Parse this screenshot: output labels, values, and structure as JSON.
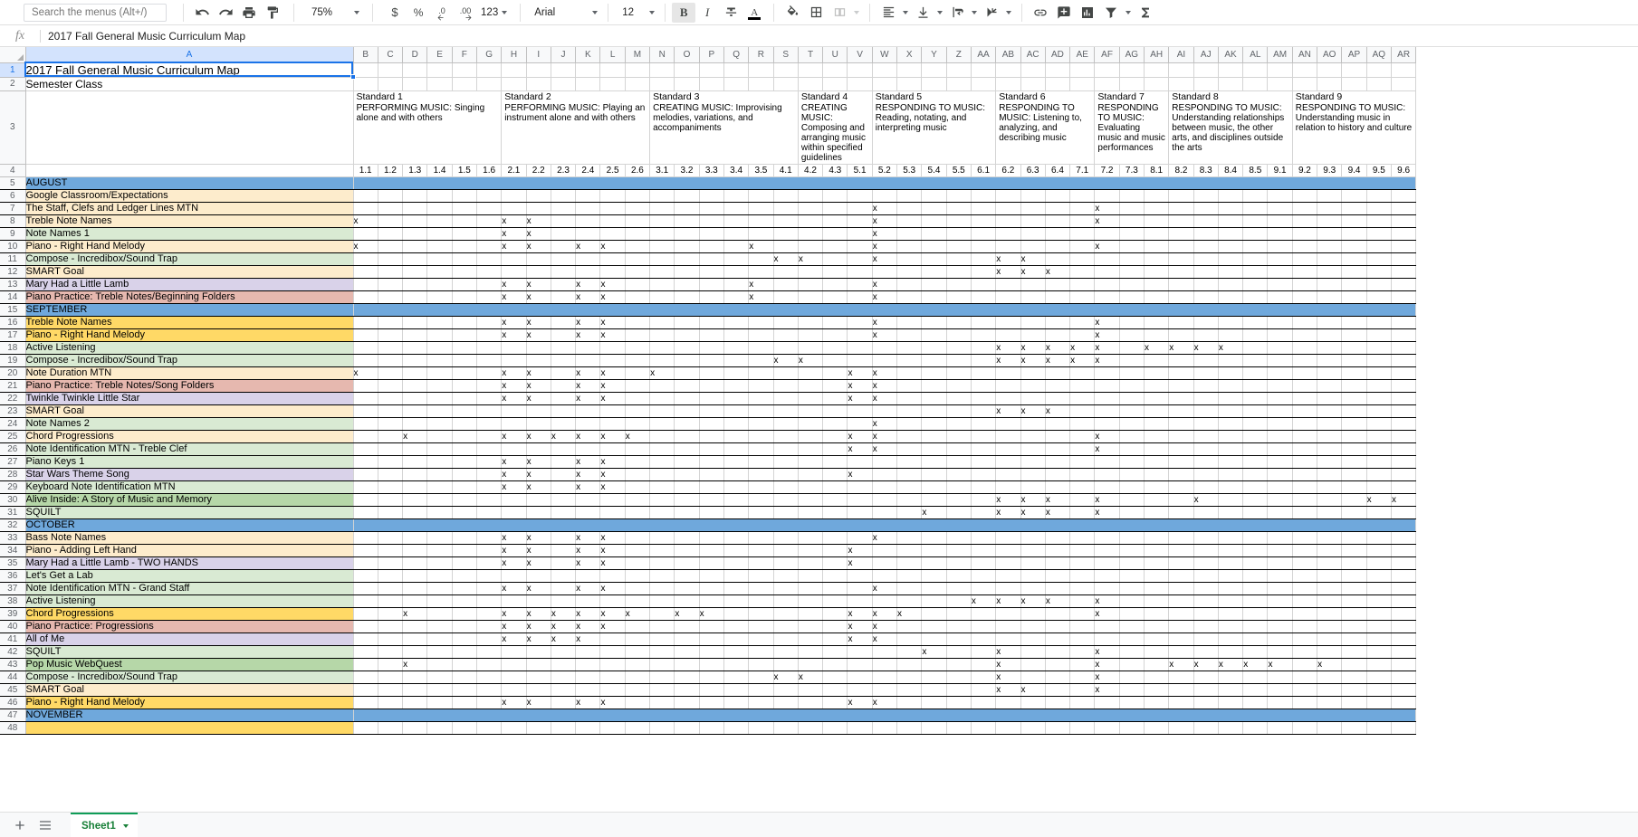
{
  "toolbar": {
    "search_placeholder": "Search the menus (Alt+/)",
    "undo": "undo-icon",
    "redo": "redo-icon",
    "print": "print-icon",
    "paint_format": "paint-format-icon",
    "zoom_value": "75%",
    "currency": "$",
    "percent": "%",
    "decrease_decimal": ".0",
    "increase_decimal": ".00",
    "more_formats": "123",
    "font_family": "Arial",
    "font_size": "12",
    "bold": "B",
    "italic": "I",
    "strikethrough": "S",
    "text_color": "A"
  },
  "formula_bar": {
    "fx_label": "fx",
    "value": "2017 Fall General Music Curriculum Map"
  },
  "columns": [
    "A",
    "B",
    "C",
    "D",
    "E",
    "F",
    "G",
    "H",
    "I",
    "J",
    "K",
    "L",
    "M",
    "N",
    "O",
    "P",
    "Q",
    "R",
    "S",
    "T",
    "U",
    "V",
    "W",
    "X",
    "Y",
    "Z",
    "AA",
    "AB",
    "AC",
    "AD",
    "AE",
    "AF",
    "AG",
    "AH",
    "AI",
    "AJ",
    "AK",
    "AL",
    "AM",
    "AN",
    "AO",
    "AP",
    "AQ",
    "AR"
  ],
  "selected_column": "A",
  "selected_row": 1,
  "header": {
    "title": "2017 Fall General Music Curriculum Map",
    "subtitle": "Semester Class"
  },
  "standards": [
    {
      "col_start": "B",
      "span": 6,
      "name": "Standard 1",
      "description": "PERFORMING MUSIC: Singing alone and with others",
      "subs": [
        "1.1",
        "1.2",
        "1.3",
        "1.4",
        "1.5",
        "1.6"
      ]
    },
    {
      "col_start": "H",
      "span": 6,
      "name": "Standard 2",
      "description": "PERFORMING MUSIC: Playing an instrument alone and with others",
      "subs": [
        "2.1",
        "2.2",
        "2.3",
        "2.4",
        "2.5",
        "2.6"
      ]
    },
    {
      "col_start": "N",
      "span": 6,
      "name": "Standard 3",
      "description": "CREATING MUSIC: Improvising melodies, variations, and accompaniments",
      "subs": [
        "3.1",
        "3.2",
        "3.3",
        "3.4",
        "3.5"
      ]
    },
    {
      "col_start": "T",
      "span": 3,
      "name": "Standard 4",
      "description": "CREATING MUSIC: Composing and arranging music within specified guidelines",
      "subs": [
        "4.1",
        "4.2",
        "4.3"
      ]
    },
    {
      "col_start": "W",
      "span": 5,
      "name": "Standard 5",
      "description": "RESPONDING TO MUSIC: Reading, notating, and interpreting music",
      "subs": [
        "5.1",
        "5.2",
        "5.3",
        "5.4",
        "5.5"
      ]
    },
    {
      "col_start": "AB",
      "span": 4,
      "name": "Standard 6",
      "description": "RESPONDING TO MUSIC: Listening to, analyzing, and describing music",
      "subs": [
        "6.1",
        "6.2",
        "6.3",
        "6.4"
      ]
    },
    {
      "col_start": "AF",
      "span": 3,
      "name": "Standard 7",
      "description": "RESPONDING TO MUSIC: Evaluating music and music performances",
      "subs": [
        "7.1",
        "7.2",
        "7.3"
      ]
    },
    {
      "col_start": "AI",
      "span": 5,
      "name": "Standard 8",
      "description": "RESPONDING TO MUSIC: Understanding relationships between music, the other arts, and disciplines outside the arts",
      "subs": [
        "8.1",
        "8.2",
        "8.3",
        "8.4",
        "8.5"
      ]
    },
    {
      "col_start": "AN",
      "span": 6,
      "name": "Standard 9",
      "description": "RESPONDING TO MUSIC: Understanding music in relation to history and culture",
      "subs": [
        "9.1",
        "9.2",
        "9.3",
        "9.4",
        "9.5",
        "9.6"
      ]
    }
  ],
  "sub_numbers": [
    "1.1",
    "1.2",
    "1.3",
    "1.4",
    "1.5",
    "1.6",
    "2.1",
    "2.2",
    "2.3",
    "2.4",
    "2.5",
    "2.6",
    "3.1",
    "3.2",
    "3.3",
    "3.4",
    "3.5",
    "4.1",
    "4.2",
    "4.3",
    "5.1",
    "5.2",
    "5.3",
    "5.4",
    "5.5",
    "6.1",
    "6.2",
    "6.3",
    "6.4",
    "7.1",
    "7.2",
    "7.3",
    "8.1",
    "8.2",
    "8.3",
    "8.4",
    "8.5",
    "9.1",
    "9.2",
    "9.3",
    "9.4",
    "9.5",
    "9.6"
  ],
  "colors": {
    "month_header": "#6fa8dc",
    "cream": "#fdeccc",
    "green_light": "#d9ead3",
    "green_mid": "#b6d7a8",
    "purple": "#d9d2e9",
    "salmon": "#e6b8af",
    "gold": "#ffd966",
    "white": "#ffffff",
    "accent_blue": "#1a73e8",
    "tab_green": "#0f9d58"
  },
  "rows": [
    {
      "n": 1,
      "label": "2017 Fall General Music Curriculum Map",
      "style": "title",
      "fill": "#ffffff",
      "marks": []
    },
    {
      "n": 2,
      "label": "Semester Class",
      "style": "subtitle",
      "fill": "#ffffff",
      "marks": []
    },
    {
      "n": 3,
      "label": "",
      "style": "std",
      "fill": "#ffffff",
      "marks": []
    },
    {
      "n": 4,
      "label": "",
      "style": "nums",
      "fill": "#ffffff",
      "marks": []
    },
    {
      "n": 5,
      "label": "AUGUST",
      "style": "month",
      "fill": "#6fa8dc",
      "marks": []
    },
    {
      "n": 6,
      "label": "Google Classroom/Expectations",
      "style": "topic",
      "fill": "#fdeccc",
      "marks": []
    },
    {
      "n": 7,
      "label": "The Staff, Clefs and Ledger Lines  MTN",
      "style": "topic",
      "fill": "#fdeccc",
      "marks": [
        "W",
        "AF"
      ]
    },
    {
      "n": 8,
      "label": "Treble Note Names",
      "style": "topic",
      "fill": "#fdeccc",
      "marks": [
        "B",
        "H",
        "I",
        "W",
        "AF"
      ]
    },
    {
      "n": 9,
      "label": "Note Names 1",
      "style": "topic",
      "fill": "#d9ead3",
      "marks": [
        "H",
        "I",
        "W"
      ]
    },
    {
      "n": 10,
      "label": "Piano - Right Hand Melody",
      "style": "topic",
      "fill": "#fdeccc",
      "marks": [
        "B",
        "H",
        "I",
        "K",
        "L",
        "R",
        "W",
        "AF"
      ]
    },
    {
      "n": 11,
      "label": "Compose - Incredibox/Sound Trap",
      "style": "topic",
      "fill": "#d9ead3",
      "marks": [
        "S",
        "T",
        "W",
        "AB",
        "AC"
      ]
    },
    {
      "n": 12,
      "label": "SMART Goal",
      "style": "topic",
      "fill": "#fdeccc",
      "marks": [
        "AB",
        "AC",
        "AD"
      ]
    },
    {
      "n": 13,
      "label": "Mary Had a Little Lamb",
      "style": "topic",
      "fill": "#d9d2e9",
      "marks": [
        "H",
        "I",
        "K",
        "L",
        "R",
        "W"
      ]
    },
    {
      "n": 14,
      "label": "Piano Practice: Treble Notes/Beginning Folders",
      "style": "topic",
      "fill": "#e6b8af",
      "marks": [
        "H",
        "I",
        "K",
        "L",
        "R",
        "W"
      ]
    },
    {
      "n": 15,
      "label": "SEPTEMBER",
      "style": "month",
      "fill": "#6fa8dc",
      "marks": []
    },
    {
      "n": 16,
      "label": "Treble Note Names",
      "style": "topic",
      "fill": "#ffd966",
      "marks": [
        "H",
        "I",
        "K",
        "L",
        "W",
        "AF"
      ]
    },
    {
      "n": 17,
      "label": "Piano - Right Hand Melody",
      "style": "topic",
      "fill": "#ffd966",
      "marks": [
        "H",
        "I",
        "K",
        "L",
        "W",
        "AF"
      ]
    },
    {
      "n": 18,
      "label": "Active Listening",
      "style": "topic",
      "fill": "#d9ead3",
      "marks": [
        "AB",
        "AC",
        "AD",
        "AE",
        "AF",
        "AH",
        "AI",
        "AJ",
        "AK"
      ]
    },
    {
      "n": 19,
      "label": "Compose - Incredibox/Sound Trap",
      "style": "topic",
      "fill": "#d9ead3",
      "marks": [
        "S",
        "T",
        "AB",
        "AC",
        "AD",
        "AE",
        "AF"
      ]
    },
    {
      "n": 20,
      "label": "Note Duration MTN",
      "style": "topic",
      "fill": "#fdeccc",
      "marks": [
        "B",
        "H",
        "I",
        "K",
        "L",
        "N",
        "V",
        "W"
      ]
    },
    {
      "n": 21,
      "label": "Piano Practice: Treble Notes/Song Folders",
      "style": "topic",
      "fill": "#e6b8af",
      "marks": [
        "H",
        "I",
        "K",
        "L",
        "V",
        "W"
      ]
    },
    {
      "n": 22,
      "label": "Twinkle Twinkle Little Star",
      "style": "topic",
      "fill": "#d9d2e9",
      "marks": [
        "H",
        "I",
        "K",
        "L",
        "V",
        "W"
      ]
    },
    {
      "n": 23,
      "label": "SMART Goal",
      "style": "topic",
      "fill": "#fdeccc",
      "marks": [
        "AB",
        "AC",
        "AD"
      ]
    },
    {
      "n": 24,
      "label": "Note Names 2",
      "style": "topic",
      "fill": "#d9ead3",
      "marks": [
        "W"
      ]
    },
    {
      "n": 25,
      "label": "Chord Progressions",
      "style": "topic",
      "fill": "#fdeccc",
      "marks": [
        "D",
        "H",
        "I",
        "J",
        "K",
        "L",
        "M",
        "V",
        "W",
        "AF"
      ]
    },
    {
      "n": 26,
      "label": "Note Identification  MTN - Treble Clef",
      "style": "topic",
      "fill": "#d9ead3",
      "marks": [
        "V",
        "W",
        "AF"
      ]
    },
    {
      "n": 27,
      "label": "Piano Keys 1",
      "style": "topic",
      "fill": "#d9ead3",
      "marks": [
        "H",
        "I",
        "K",
        "L"
      ]
    },
    {
      "n": 28,
      "label": "Star Wars Theme Song",
      "style": "topic",
      "fill": "#d9d2e9",
      "marks": [
        "H",
        "I",
        "K",
        "L",
        "V"
      ]
    },
    {
      "n": 29,
      "label": "Keyboard Note Identification MTN",
      "style": "topic",
      "fill": "#d9ead3",
      "marks": [
        "H",
        "I",
        "K",
        "L"
      ]
    },
    {
      "n": 30,
      "label": "Alive Inside: A Story of Music and Memory",
      "style": "topic",
      "fill": "#b6d7a8",
      "marks": [
        "AB",
        "AC",
        "AD",
        "AF",
        "AJ",
        "AQ",
        "AR"
      ]
    },
    {
      "n": 31,
      "label": "SQUILT",
      "style": "topic",
      "fill": "#d9ead3",
      "marks": [
        "Y",
        "AB",
        "AC",
        "AD",
        "AF"
      ]
    },
    {
      "n": 32,
      "label": "OCTOBER",
      "style": "month",
      "fill": "#6fa8dc",
      "marks": []
    },
    {
      "n": 33,
      "label": "Bass Note Names",
      "style": "topic",
      "fill": "#fdeccc",
      "marks": [
        "H",
        "I",
        "K",
        "L",
        "W"
      ]
    },
    {
      "n": 34,
      "label": "Piano - Adding Left Hand",
      "style": "topic",
      "fill": "#fdeccc",
      "marks": [
        "H",
        "I",
        "K",
        "L",
        "V"
      ]
    },
    {
      "n": 35,
      "label": "Mary Had a Little Lamb - TWO HANDS",
      "style": "topic",
      "fill": "#d9d2e9",
      "marks": [
        "H",
        "I",
        "K",
        "L",
        "V"
      ]
    },
    {
      "n": 36,
      "label": "Let's Get a Lab",
      "style": "topic",
      "fill": "#d9ead3",
      "marks": []
    },
    {
      "n": 37,
      "label": "Note Identification  MTN - Grand Staff",
      "style": "topic",
      "fill": "#d9ead3",
      "marks": [
        "H",
        "I",
        "K",
        "L",
        "W"
      ]
    },
    {
      "n": 38,
      "label": "Active Listening",
      "style": "topic",
      "fill": "#d9ead3",
      "marks": [
        "AA",
        "AB",
        "AC",
        "AD",
        "AF"
      ]
    },
    {
      "n": 39,
      "label": "Chord Progressions",
      "style": "topic",
      "fill": "#ffd966",
      "marks": [
        "D",
        "H",
        "I",
        "J",
        "K",
        "L",
        "M",
        "O",
        "P",
        "V",
        "W",
        "X",
        "AF"
      ]
    },
    {
      "n": 40,
      "label": "Piano Practice: Progressions",
      "style": "topic",
      "fill": "#e6b8af",
      "marks": [
        "H",
        "I",
        "J",
        "K",
        "L",
        "V",
        "W"
      ]
    },
    {
      "n": 41,
      "label": "All of Me",
      "style": "topic",
      "fill": "#d9d2e9",
      "marks": [
        "H",
        "I",
        "J",
        "K",
        "V",
        "W"
      ]
    },
    {
      "n": 42,
      "label": "SQUILT",
      "style": "topic",
      "fill": "#d9ead3",
      "marks": [
        "Y",
        "AB",
        "AF"
      ]
    },
    {
      "n": 43,
      "label": "Pop Music WebQuest",
      "style": "topic",
      "fill": "#b6d7a8",
      "marks": [
        "D",
        "AB",
        "AF",
        "AI",
        "AJ",
        "AK",
        "AL",
        "AM",
        "AO"
      ]
    },
    {
      "n": 44,
      "label": "Compose - Incredibox/Sound Trap",
      "style": "topic",
      "fill": "#d9ead3",
      "marks": [
        "S",
        "T",
        "AB",
        "AF"
      ]
    },
    {
      "n": 45,
      "label": "SMART Goal",
      "style": "topic",
      "fill": "#fdeccc",
      "marks": [
        "AB",
        "AC",
        "AF"
      ]
    },
    {
      "n": 46,
      "label": "Piano - Right Hand Melody",
      "style": "topic",
      "fill": "#ffd966",
      "marks": [
        "H",
        "I",
        "K",
        "L",
        "V",
        "W"
      ]
    },
    {
      "n": 47,
      "label": "NOVEMBER",
      "style": "month",
      "fill": "#6fa8dc",
      "marks": []
    },
    {
      "n": 48,
      "label": "",
      "style": "topic",
      "fill": "#ffd966",
      "marks": []
    }
  ],
  "bottom": {
    "add_sheet": "add-sheet-icon",
    "all_sheets": "all-sheets-icon",
    "sheet_name": "Sheet1"
  }
}
